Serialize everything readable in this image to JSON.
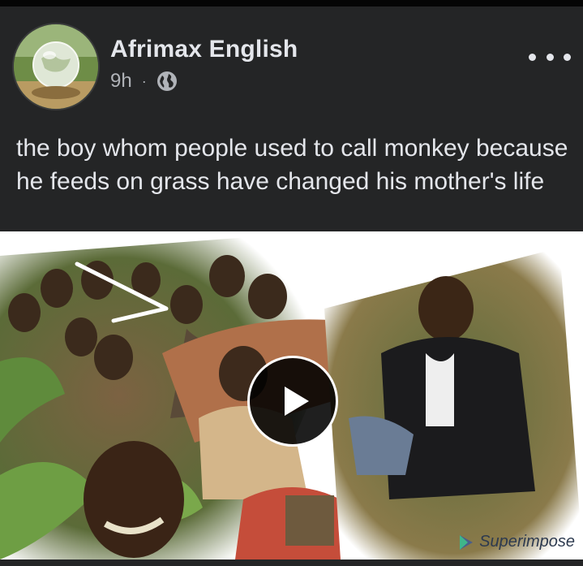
{
  "post": {
    "author": "Afrimax English",
    "time": "9h",
    "separator": "·",
    "privacy_icon": "globe-icon",
    "menu_icon": "more-options-icon",
    "caption": "the boy whom people used to call monkey because he feeds on grass have changed his mother's life"
  },
  "media": {
    "type": "video",
    "play_icon": "play-icon",
    "watermark": "Superimpose"
  },
  "colors": {
    "background": "#242526",
    "primary_text": "#e4e6eb",
    "secondary_text": "#b0b3b8"
  }
}
